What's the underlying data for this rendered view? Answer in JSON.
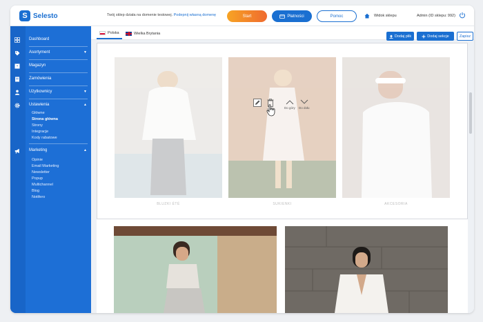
{
  "app": {
    "logo_text": "Selesto",
    "logo_letter": "S",
    "brand_color": "#1a6fd1"
  },
  "topbar": {
    "notice_text": "Twój sklep działa na domenie testowej.",
    "notice_link": "Podepnij własną domenę",
    "start_label": "Start",
    "payments_label": "Płatności",
    "help_label": "Pomoc",
    "shop_view_label": "Widok sklepu",
    "admin_label": "Admin (ID sklepu: 992)"
  },
  "sidebar": {
    "items": [
      {
        "label": "Dashboard",
        "icon": "grid-icon"
      },
      {
        "label": "Asortyment",
        "icon": "tag-icon",
        "chevron": "▼"
      },
      {
        "label": "Magazyn",
        "icon": "box-icon"
      },
      {
        "label": "Zamówienia",
        "icon": "document-icon"
      },
      {
        "label": "Użytkownicy",
        "icon": "user-icon",
        "chevron": "▼"
      },
      {
        "label": "Ustawienia",
        "icon": "gear-icon",
        "chevron": "▲"
      },
      {
        "label": "Marketing",
        "icon": "megaphone-icon",
        "chevron": "▲"
      }
    ],
    "settings_sub": [
      "Główne",
      "Strona główna",
      "Strony",
      "Integracje",
      "Kody rabatowe"
    ],
    "marketing_sub": [
      "Opinie",
      "Email Marketing",
      "Newsletter",
      "Popup",
      "Multichannel",
      "Blog",
      "Notifero"
    ]
  },
  "main": {
    "lang_tabs": [
      {
        "label": "Polska",
        "flag": "pl"
      },
      {
        "label": "Wielka Brytania",
        "flag": "gb"
      }
    ],
    "upload_label": "Dodaj plik",
    "add_section_label": "Dodaj sekcje",
    "save_label": "Zapisz",
    "tools": {
      "delete": "Usuń",
      "up": "Do góry",
      "down": "Do dołu"
    },
    "captions": [
      "BLUZKI ÉTÉ",
      "SUKIENKI",
      "AKCESORIA"
    ]
  }
}
